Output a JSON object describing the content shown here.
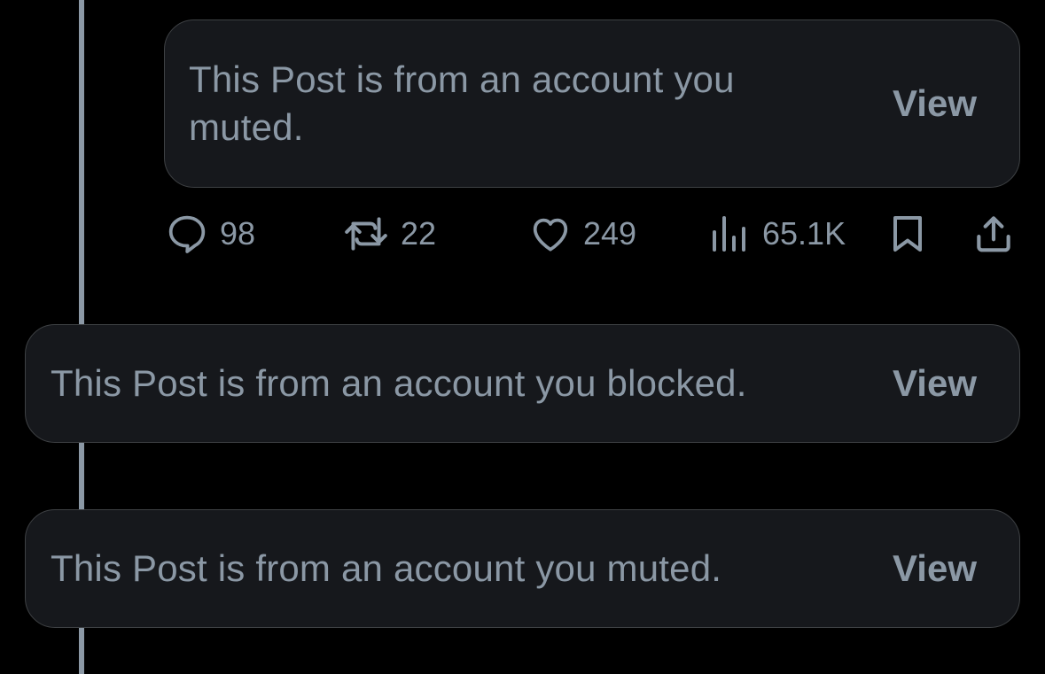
{
  "muted_reply": {
    "text": "This Post is from an account you muted.",
    "view_label": "View"
  },
  "engagement": {
    "replies": "98",
    "reposts": "22",
    "likes": "249",
    "views": "65.1K"
  },
  "icons": {
    "reply": "speech-bubble-icon",
    "repost": "repost-arrows-icon",
    "like": "heart-icon",
    "views": "bar-chart-icon",
    "bookmark": "bookmark-icon",
    "share": "share-upload-icon"
  },
  "blocked_post": {
    "text": "This Post is from an account you blocked.",
    "view_label": "View"
  },
  "muted_post": {
    "text": "This Post is from an account you muted.",
    "view_label": "View"
  },
  "colors": {
    "background": "#000000",
    "card": "#16181c",
    "card_border": "#3e4144",
    "text": "#8b98a5",
    "thread_line": "#8b98a5"
  }
}
